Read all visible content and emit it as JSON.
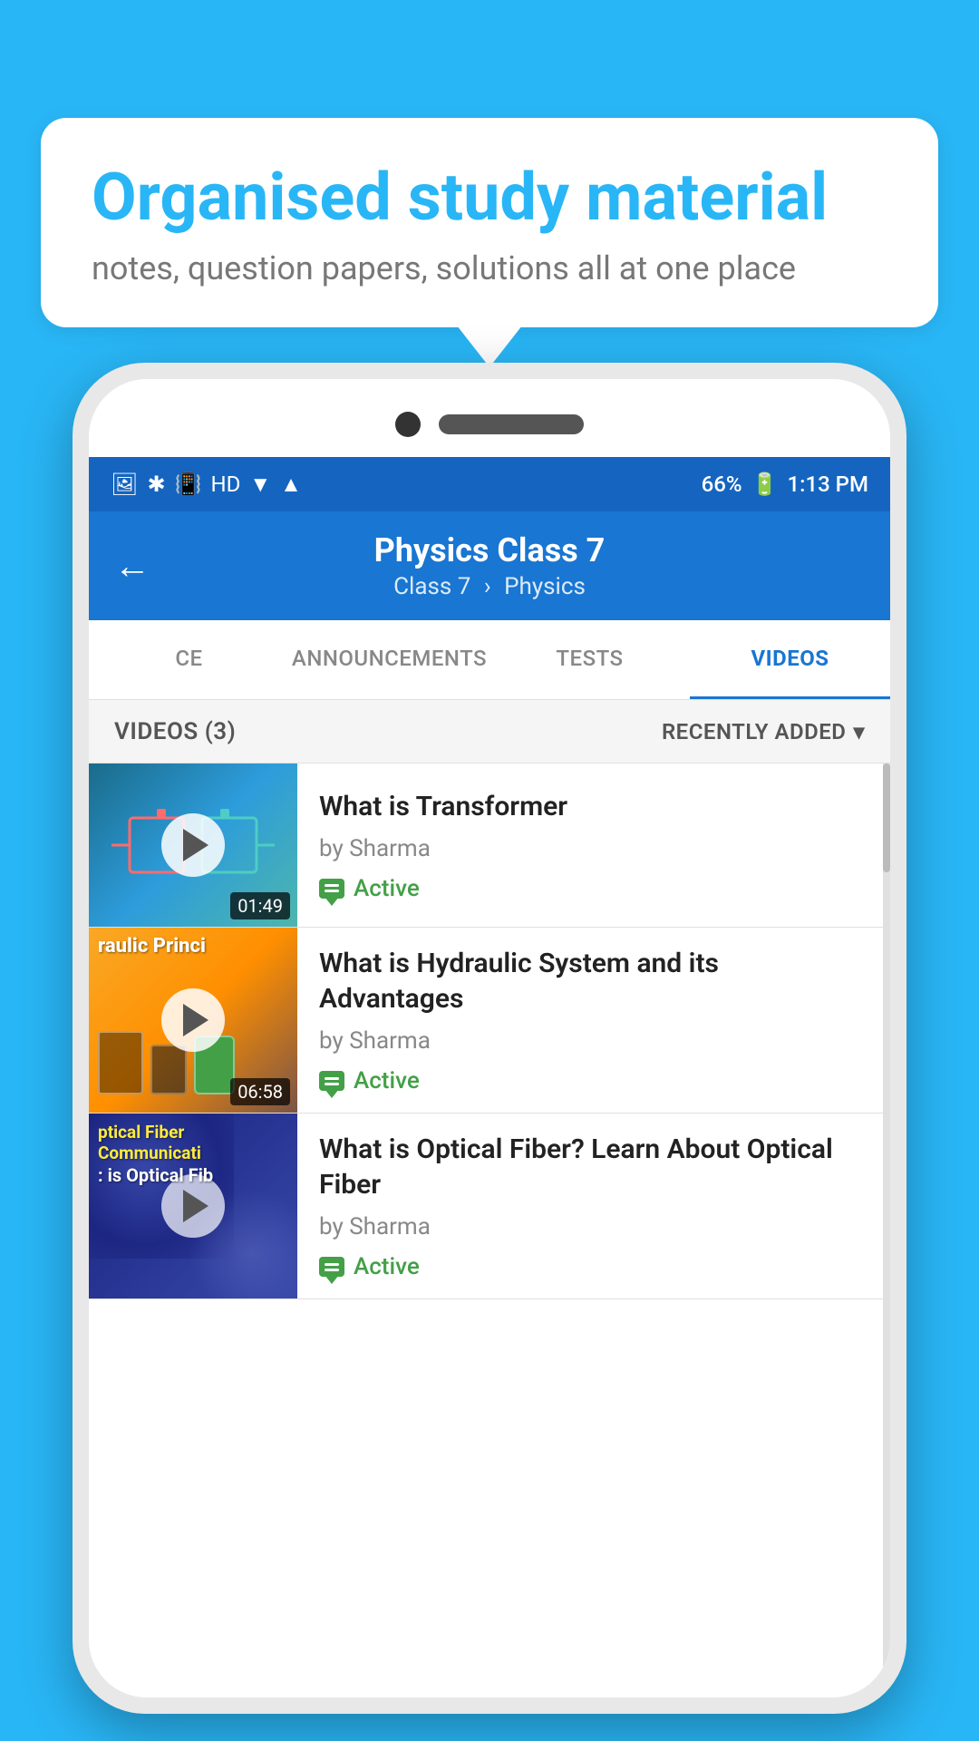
{
  "background": {
    "color": "#29b6f6"
  },
  "speech_bubble": {
    "title": "Organised study material",
    "subtitle": "notes, question papers, solutions all at one place"
  },
  "status_bar": {
    "battery": "66%",
    "time": "1:13 PM",
    "signal": "HD"
  },
  "app_bar": {
    "title": "Physics Class 7",
    "breadcrumb1": "Class 7",
    "breadcrumb2": "Physics",
    "back_label": "←"
  },
  "tabs": [
    {
      "label": "CE",
      "active": false
    },
    {
      "label": "ANNOUNCEMENTS",
      "active": false
    },
    {
      "label": "TESTS",
      "active": false
    },
    {
      "label": "VIDEOS",
      "active": true
    }
  ],
  "videos_header": {
    "count_label": "VIDEOS (3)",
    "sort_label": "RECENTLY ADDED"
  },
  "videos": [
    {
      "title": "What is  Transformer",
      "author": "by Sharma",
      "status": "Active",
      "duration": "01:49",
      "thumb_text": ""
    },
    {
      "title": "What is Hydraulic System and its Advantages",
      "author": "by Sharma",
      "status": "Active",
      "duration": "06:58",
      "thumb_text": "raulic Princi"
    },
    {
      "title": "What is Optical Fiber? Learn About Optical Fiber",
      "author": "by Sharma",
      "status": "Active",
      "duration": "",
      "thumb_text": "ptical Fiber Communicati"
    }
  ]
}
